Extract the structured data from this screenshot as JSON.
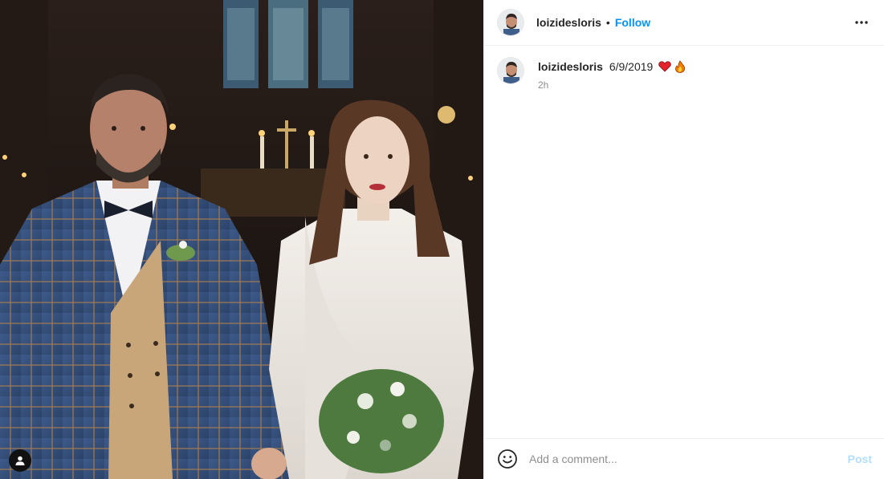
{
  "post": {
    "username": "loizidesloris",
    "follow_label": "Follow",
    "separator": "•",
    "caption_text": "6/9/2019",
    "caption_emojis": [
      "heart",
      "fire"
    ],
    "timestamp": "2h"
  },
  "comment": {
    "placeholder": "Add a comment...",
    "post_label": "Post"
  },
  "colors": {
    "accent": "#0095f6",
    "post_disabled": "#b2dffc",
    "muted": "#8e8e8e"
  },
  "icons": [
    "user-tag-icon",
    "more-options-icon",
    "emoji-icon"
  ]
}
